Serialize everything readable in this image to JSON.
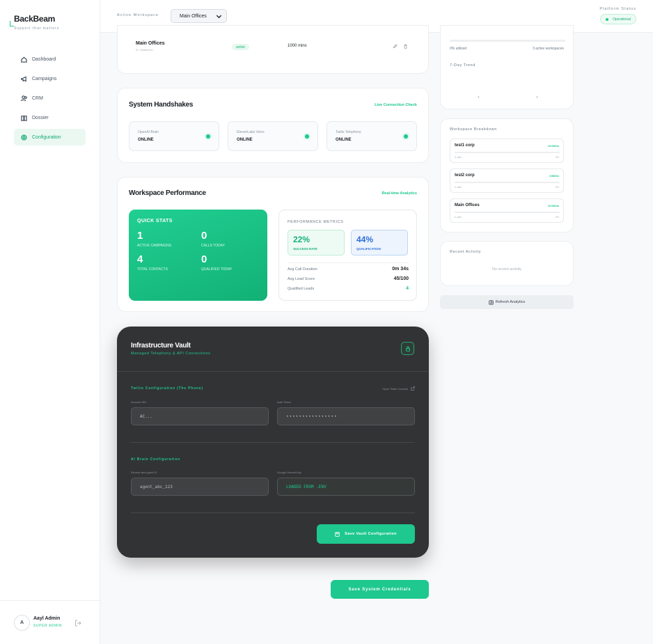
{
  "brand": {
    "name": "BackBeam",
    "tagline": "Support that matters"
  },
  "nav": [
    {
      "label": "Dashboard",
      "icon": "home-icon"
    },
    {
      "label": "Campaigns",
      "icon": "megaphone-icon"
    },
    {
      "label": "CRM",
      "icon": "users-icon"
    },
    {
      "label": "Dossier",
      "icon": "book-icon"
    },
    {
      "label": "Configuration",
      "icon": "gear-icon",
      "active": true
    }
  ],
  "user": {
    "initial": "A",
    "name": "Aayl Admin",
    "role": "SUPER ADMIN"
  },
  "topbar": {
    "workspace_label": "Active Workspace",
    "workspace_value": "Main Offices",
    "platform_label": "Platform Status",
    "platform_status": "Operational"
  },
  "workspace_row": {
    "name": "Main Offices",
    "id": "ID: 96d8e0e4...",
    "status": "active",
    "minutes": "1000 mins"
  },
  "handshakes": {
    "title": "System Handshakes",
    "link": "Live Connection Check",
    "items": [
      {
        "name": "OpenAI Brain",
        "status": "ONLINE"
      },
      {
        "name": "ElevenLabs Voice",
        "status": "ONLINE"
      },
      {
        "name": "Twilio Telephony",
        "status": "ONLINE"
      }
    ]
  },
  "performance": {
    "title": "Workspace Performance",
    "link": "Real-time Analytics",
    "quick_stats_title": "QUICK STATS",
    "stats": [
      {
        "value": "1",
        "label": "ACTIVE CAMPAIGNS"
      },
      {
        "value": "0",
        "label": "CALLS TODAY"
      },
      {
        "value": "4",
        "label": "TOTAL CONTACTS"
      },
      {
        "value": "0",
        "label": "QUALIFIED TODAY"
      }
    ],
    "metrics_title": "PERFORMANCE METRICS",
    "success_rate": "22%",
    "success_label": "SUCCESS RATE",
    "qualification": "44%",
    "qualification_label": "QUALIFICATION",
    "rows": [
      {
        "label": "Avg Call Duration",
        "value": "0m 34s"
      },
      {
        "label": "Avg Lead Score",
        "value": "45/100"
      },
      {
        "label": "Qualified Leads",
        "value": "4"
      }
    ]
  },
  "vault": {
    "title": "Infrastructure Vault",
    "subtitle": "Managed Telephony & API Connections",
    "twilio_title": "Twilio Configuration (The Phone)",
    "twilio_console": "Open Twilio Console",
    "account_sid_label": "Account SID",
    "account_sid_value": "AC...",
    "auth_token_label": "Auth Token",
    "auth_token_value": "••••••••••••••••",
    "ai_title": "AI Brain Configuration",
    "agent_id_label": "ElevenLabs Agent ID",
    "agent_id_value": "agent_abc_123",
    "gemini_label": "Google Gemini Key",
    "gemini_value": "LOADED FROM .ENV",
    "save_button": "Save Vault Configuration"
  },
  "save_credentials": "Save System Credentials",
  "right": {
    "utilized": "0% utilized",
    "active_workspaces": "3 active workspaces",
    "trend_title": "7-Day Trend",
    "breakdown_title": "Workspace Breakdown",
    "breakdown": [
      {
        "name": "test1 corp",
        "usage": "0/1000m",
        "calls": "0 calls",
        "percent": "0%"
      },
      {
        "name": "test2 corp",
        "usage": "0/800m",
        "calls": "0 calls",
        "percent": "0%"
      },
      {
        "name": "Main Offices",
        "usage": "0/1000m",
        "calls": "0 calls",
        "percent": "0%"
      }
    ],
    "recent_title": "Recent Activity",
    "recent_empty": "No recent activity",
    "refresh": "Refresh Analytics"
  },
  "colors": {
    "accent": "#1ec88e",
    "vault_bg": "#323334",
    "qualification_blue": "#2f6fd6"
  }
}
